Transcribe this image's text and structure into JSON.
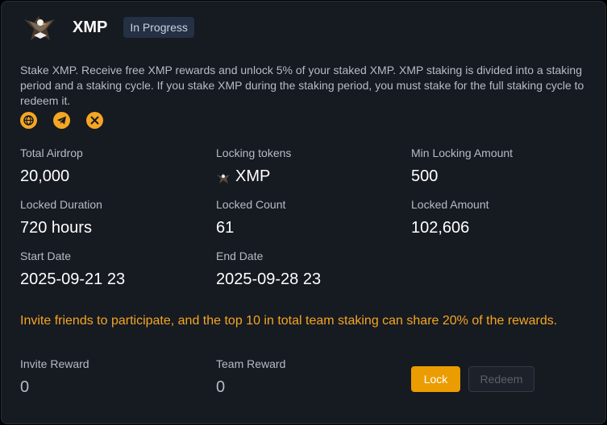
{
  "header": {
    "title": "XMP",
    "status": "In Progress"
  },
  "description": "Stake XMP. Receive free XMP rewards and unlock 5% of your staked XMP. XMP staking is divided into a staking period and a staking cycle. If you stake XMP during the staking period, you must stake for the full staking cycle to redeem it.",
  "socials": [
    "website-icon",
    "telegram-icon",
    "x-icon"
  ],
  "stats": {
    "total_airdrop": {
      "label": "Total Airdrop",
      "value": "20,000"
    },
    "locking_tokens": {
      "label": "Locking tokens",
      "value": "XMP"
    },
    "min_locking_amount": {
      "label": "Min Locking Amount",
      "value": "500"
    },
    "locked_duration": {
      "label": "Locked Duration",
      "value": "720 hours"
    },
    "locked_count": {
      "label": "Locked Count",
      "value": "61"
    },
    "locked_amount": {
      "label": "Locked Amount",
      "value": "102,606"
    },
    "start_date": {
      "label": "Start Date",
      "value": "2025-09-21 23"
    },
    "end_date": {
      "label": "End Date",
      "value": "2025-09-28 23"
    }
  },
  "invite_text": "Invite friends to participate, and the top 10 in total team staking can share 20% of the rewards.",
  "rewards": {
    "invite": {
      "label": "Invite Reward",
      "value": "0"
    },
    "team": {
      "label": "Team Reward",
      "value": "0"
    }
  },
  "buttons": {
    "lock": "Lock",
    "redeem": "Redeem"
  },
  "colors": {
    "accent": "#f5a623",
    "lock_button": "#eb9c00",
    "badge_bg": "#243044",
    "card_bg": "#161a21"
  }
}
